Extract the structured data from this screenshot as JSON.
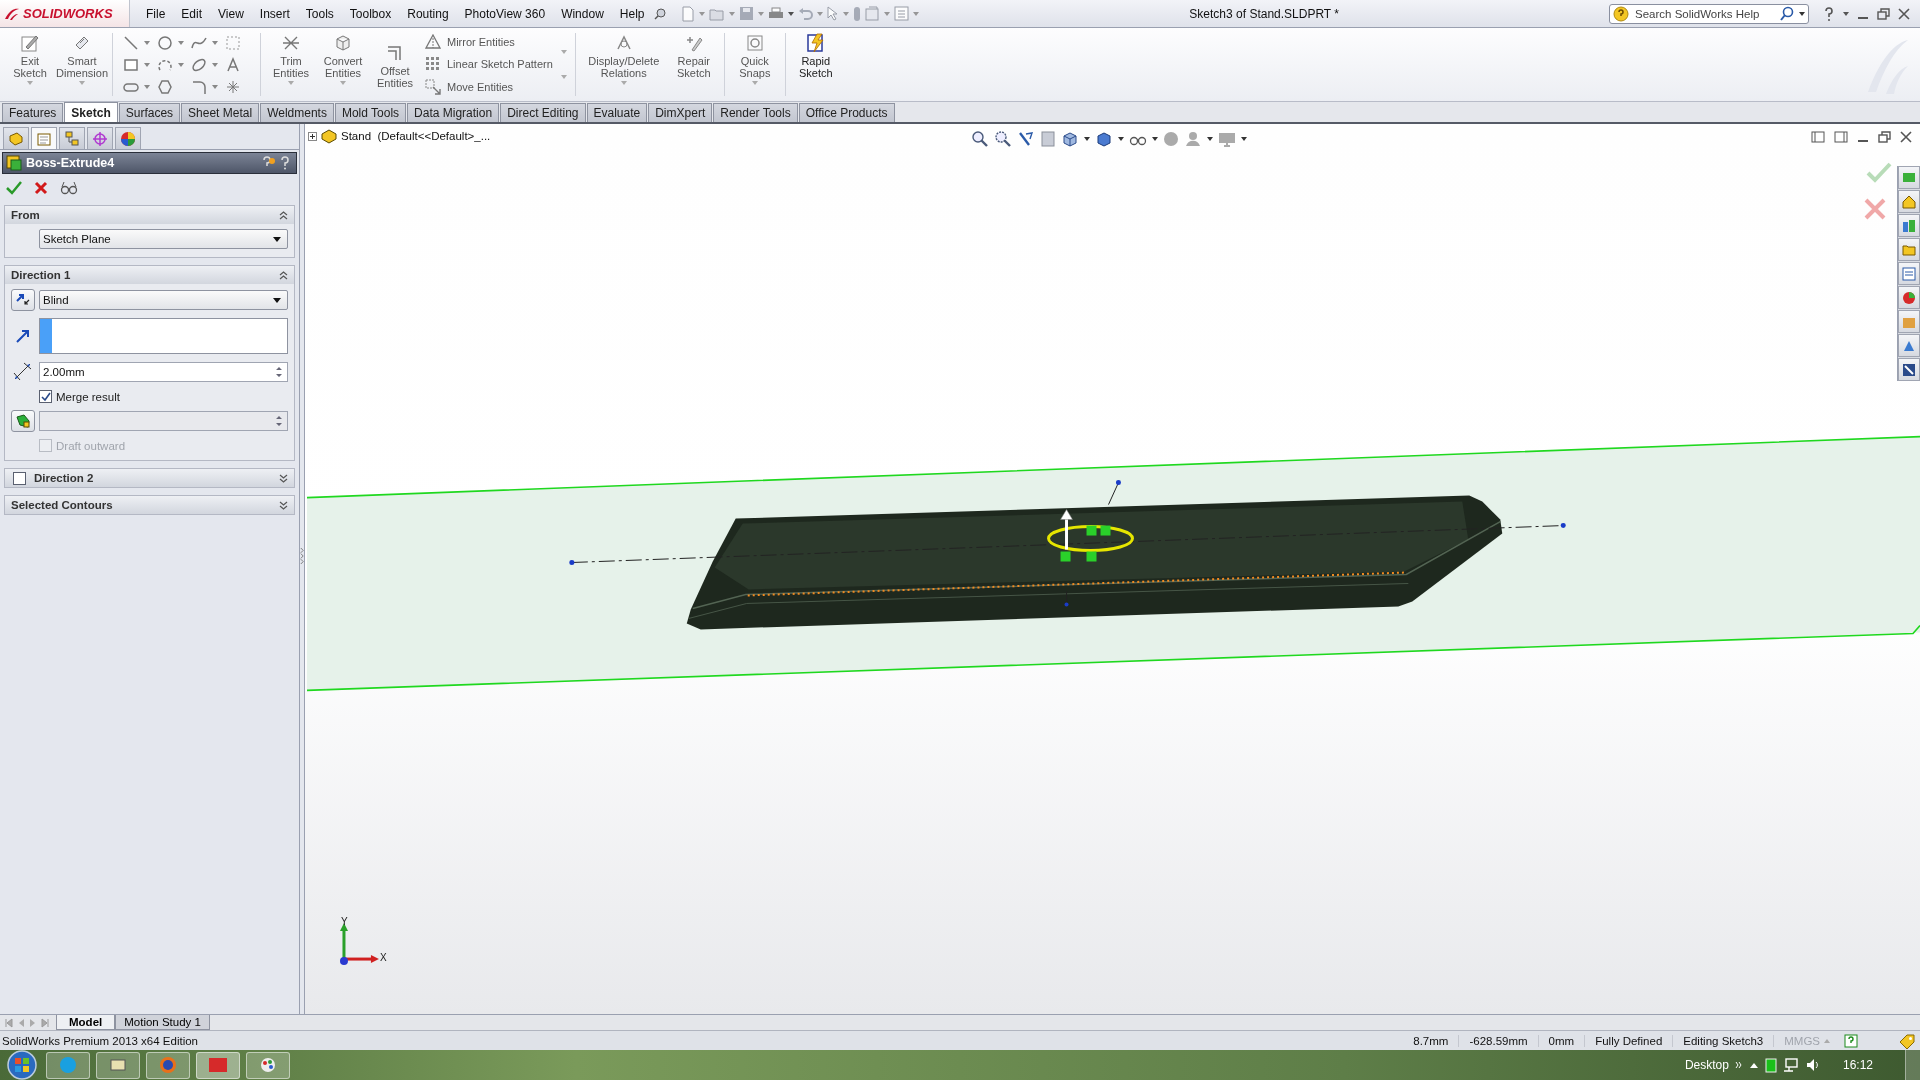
{
  "logo": "SOLIDWORKS",
  "menu": [
    "File",
    "Edit",
    "View",
    "Insert",
    "Tools",
    "Toolbox",
    "Routing",
    "PhotoView 360",
    "Window",
    "Help"
  ],
  "document_title": "Sketch3 of Stand.SLDPRT *",
  "help_search": {
    "placeholder": "Search SolidWorks Help"
  },
  "ribbon": {
    "sketch_commands": [
      "Exit Sketch",
      "Smart Dimension"
    ],
    "entity_commands": [
      "Trim Entities",
      "Convert Entities",
      "Offset Entities"
    ],
    "pattern_commands": [
      "Mirror Entities",
      "Linear Sketch Pattern",
      "Move Entities"
    ],
    "relation_commands": [
      "Display/Delete Relations",
      "Repair Sketch",
      "Quick Snaps",
      "Rapid Sketch"
    ]
  },
  "command_tabs": [
    {
      "label": "Features",
      "selected": false
    },
    {
      "label": "Sketch",
      "selected": true
    },
    {
      "label": "Surfaces",
      "selected": false
    },
    {
      "label": "Sheet Metal",
      "selected": false
    },
    {
      "label": "Weldments",
      "selected": false
    },
    {
      "label": "Mold Tools",
      "selected": false
    },
    {
      "label": "Data Migration",
      "selected": false
    },
    {
      "label": "Direct Editing",
      "selected": false
    },
    {
      "label": "Evaluate",
      "selected": false
    },
    {
      "label": "DimXpert",
      "selected": false
    },
    {
      "label": "Render Tools",
      "selected": false
    },
    {
      "label": "Office Products",
      "selected": false
    }
  ],
  "panel_tabs": [
    {
      "selected": false
    },
    {
      "selected": true
    },
    {
      "selected": false
    },
    {
      "selected": false
    },
    {
      "selected": false
    }
  ],
  "property_manager": {
    "title": "Boss-Extrude4",
    "sections": [
      {
        "kind": "from",
        "title": "From",
        "expanded": true,
        "start": "Sketch Plane"
      },
      {
        "kind": "direction",
        "title": "Direction 1",
        "expanded": true,
        "end_condition": "Blind",
        "depth": "2.00mm",
        "merge_result": {
          "label": "Merge result",
          "checked": true
        },
        "draft_outward": {
          "label": "Draft outward",
          "checked": false,
          "disabled": true
        }
      },
      {
        "kind": "direction",
        "title": "Direction 2",
        "expanded": false,
        "checked": false
      },
      {
        "kind": "contours",
        "title": "Selected Contours",
        "expanded": false
      }
    ]
  },
  "viewport": {
    "tree_item": "Stand  (Default<<Default>_...",
    "triad": {
      "x": "X",
      "y": "Y"
    }
  },
  "bottom_tabs": [
    {
      "label": "Model",
      "selected": true
    },
    {
      "label": "Motion Study 1",
      "selected": false
    }
  ],
  "status_bar": {
    "edition": "SolidWorks Premium 2013 x64 Edition",
    "fields": [
      "8.7mm",
      "-628.59mm",
      "0mm",
      "Fully Defined",
      "Editing Sketch3"
    ],
    "units": {
      "label": "MMGS",
      "disabled": true
    }
  },
  "taskbar": {
    "toolbar_label": "Desktop",
    "clock": "16:12"
  }
}
